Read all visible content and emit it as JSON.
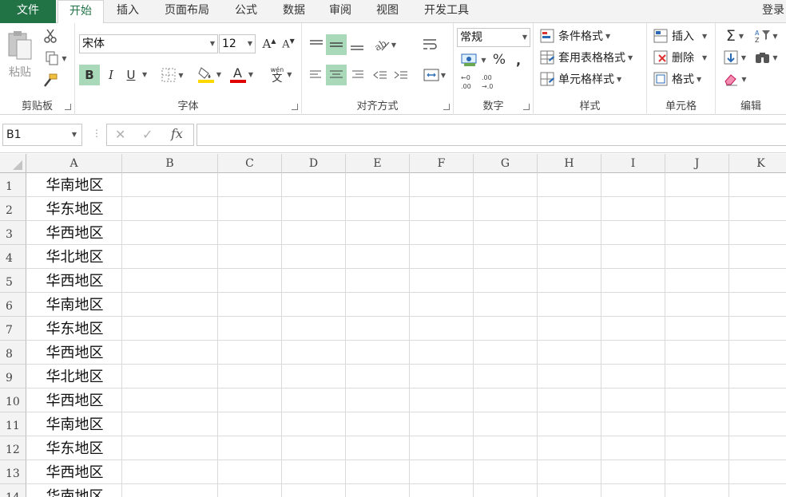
{
  "tabs": {
    "file": "文件",
    "items": [
      "开始",
      "插入",
      "页面布局",
      "公式",
      "数据",
      "审阅",
      "视图",
      "开发工具"
    ],
    "login": "登录"
  },
  "ribbon": {
    "clipboard": {
      "label": "剪贴板",
      "paste": "粘贴"
    },
    "font": {
      "label": "字体",
      "family": "宋体",
      "size": "12",
      "bold": "B",
      "italic": "I",
      "underline": "U",
      "phonetic": "wén",
      "phonetic_char": "文"
    },
    "alignment": {
      "label": "对齐方式"
    },
    "number": {
      "label": "数字",
      "format": "常规",
      "percent": "%",
      "comma": ","
    },
    "styles": {
      "label": "样式",
      "conditional": "条件格式",
      "table": "套用表格格式",
      "cell": "单元格样式"
    },
    "cells": {
      "label": "单元格",
      "insert": "插入",
      "delete": "删除",
      "format": "格式"
    },
    "editing": {
      "label": "编辑"
    }
  },
  "formula_bar": {
    "name_box": "B1",
    "fx": "fx",
    "value": ""
  },
  "grid": {
    "columns": [
      "A",
      "B",
      "C",
      "D",
      "E",
      "F",
      "G",
      "H",
      "I",
      "J",
      "K"
    ],
    "rows": [
      "1",
      "2",
      "3",
      "4",
      "5",
      "6",
      "7",
      "8",
      "9",
      "10",
      "11",
      "12",
      "13",
      "14"
    ],
    "col_a_values": [
      "华南地区",
      "华东地区",
      "华西地区",
      "华北地区",
      "华西地区",
      "华南地区",
      "华东地区",
      "华西地区",
      "华北地区",
      "华西地区",
      "华南地区",
      "华东地区",
      "华西地区",
      "华南地区"
    ]
  },
  "colors": {
    "accent": "#217346",
    "selected_button": "#a9d9b8",
    "font_color": "#e00000",
    "fill_color": "#ffd800"
  }
}
